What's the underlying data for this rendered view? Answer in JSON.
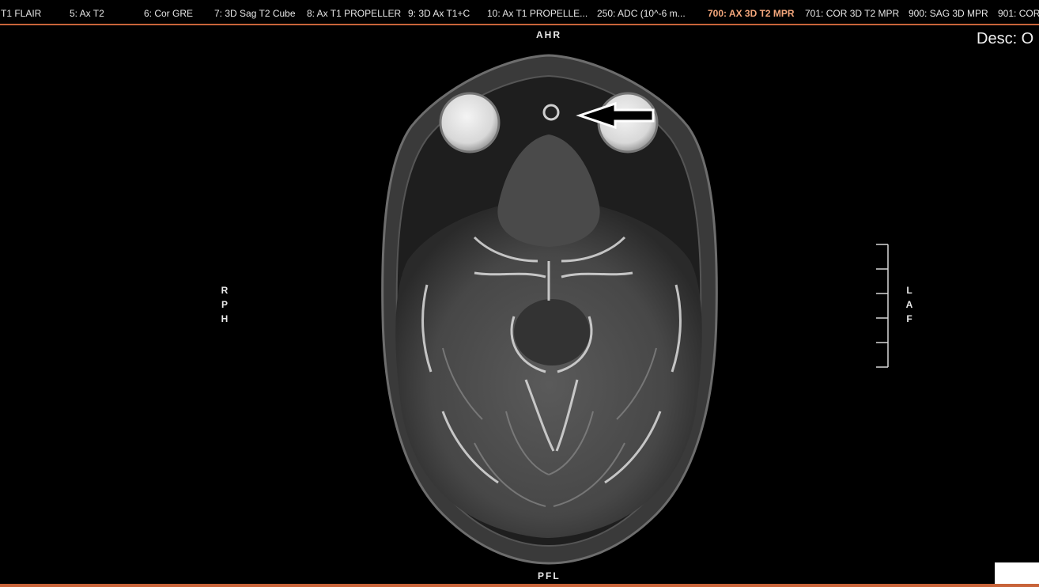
{
  "series_tabs": [
    {
      "label": "T1 FLAIR",
      "active": false
    },
    {
      "label": "5: Ax T2",
      "active": false
    },
    {
      "label": "6: Cor GRE",
      "active": false
    },
    {
      "label": "7: 3D Sag T2 Cube",
      "active": false
    },
    {
      "label": "8: Ax T1 PROPELLER",
      "active": false
    },
    {
      "label": "9: 3D Ax T1+C",
      "active": false
    },
    {
      "label": "10: Ax T1 PROPELLE...",
      "active": false
    },
    {
      "label": "250: ADC (10^-6 m...",
      "active": false
    },
    {
      "label": "700: AX 3D T2 MPR",
      "active": true
    },
    {
      "label": "701: COR 3D T2 MPR",
      "active": false
    },
    {
      "label": "900: SAG 3D MPR",
      "active": false
    },
    {
      "label": "901: COR",
      "active": false
    }
  ],
  "orientation": {
    "top": "AHR",
    "bottom": "PFL",
    "left": [
      "R",
      "P",
      "H"
    ],
    "right": [
      "L",
      "A",
      "F"
    ]
  },
  "overlay": {
    "desc": "Desc: O"
  },
  "colors": {
    "accent": "#c8643a",
    "active_tab": "#f4a77c",
    "background": "#000000"
  }
}
